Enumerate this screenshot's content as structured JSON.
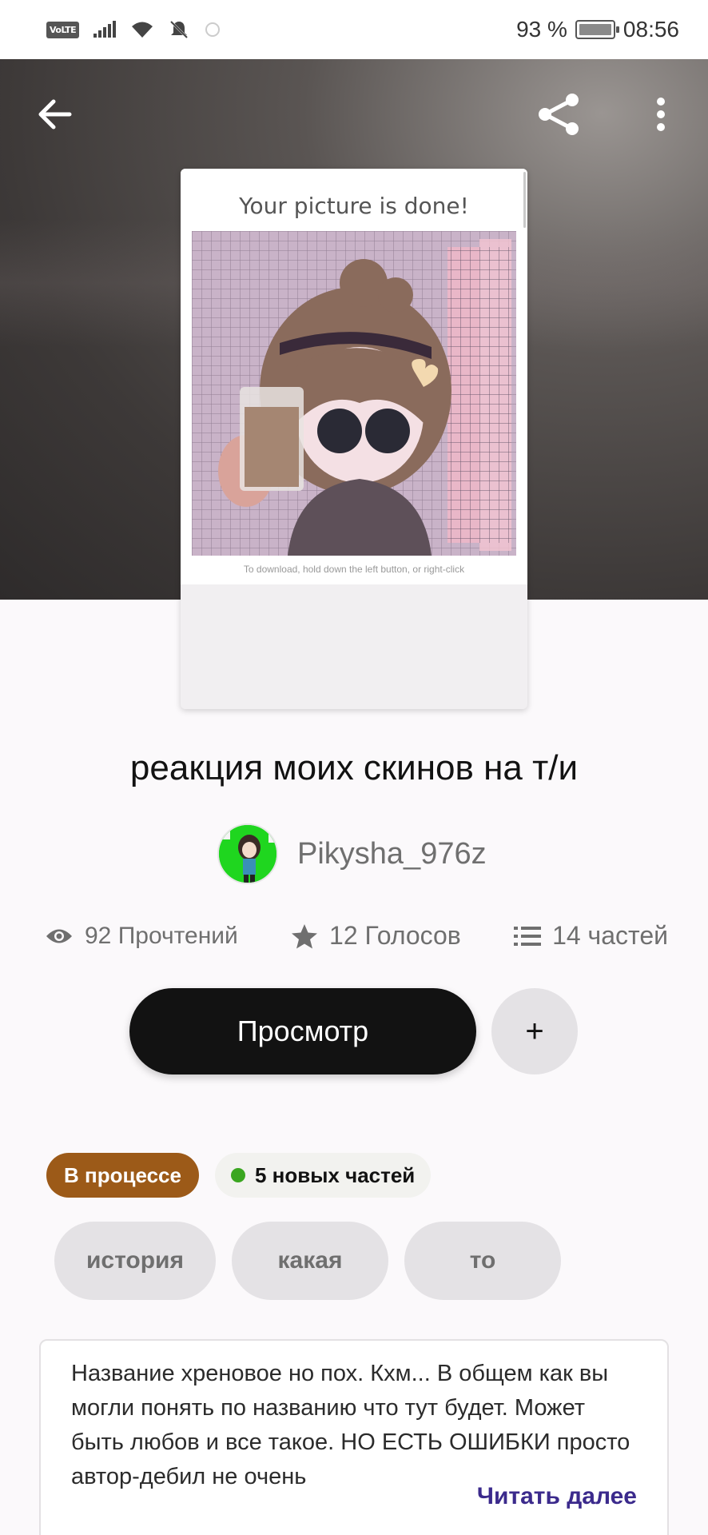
{
  "status_bar": {
    "volte": "VoLTE",
    "battery": "93 %",
    "time": "08:56"
  },
  "toolbar": {
    "back_icon": "arrow-left-icon",
    "share_icon": "share-icon",
    "menu_icon": "more-vertical-icon"
  },
  "cover": {
    "title": "Your picture is done!",
    "caption": "To download, hold down the left button, or right-click"
  },
  "story": {
    "title": "реакция моих скинов на т/и",
    "author": "Pikysha_976z"
  },
  "stats": {
    "reads": "92 Прочтений",
    "votes": "12 Голосов",
    "parts": "14 частей"
  },
  "actions": {
    "read_label": "Просмотр",
    "add_label": "+"
  },
  "badges": {
    "status": "В процессе",
    "new_parts": "5 новых частей"
  },
  "tags": [
    "история",
    "какая",
    "то"
  ],
  "description": {
    "text": "Название хреновое но пох. Кхм... В общем как вы могли понять по названию что тут будет. Может быть любов и все такое. НО ЕСТЬ ОШИБКИ  просто автор-дебил не очень",
    "more_label": "Читать далее"
  },
  "colors": {
    "status_badge": "#9c5a18",
    "new_dot": "#3aa620",
    "read_more": "#3b2a8c",
    "primary_button": "#121212"
  }
}
